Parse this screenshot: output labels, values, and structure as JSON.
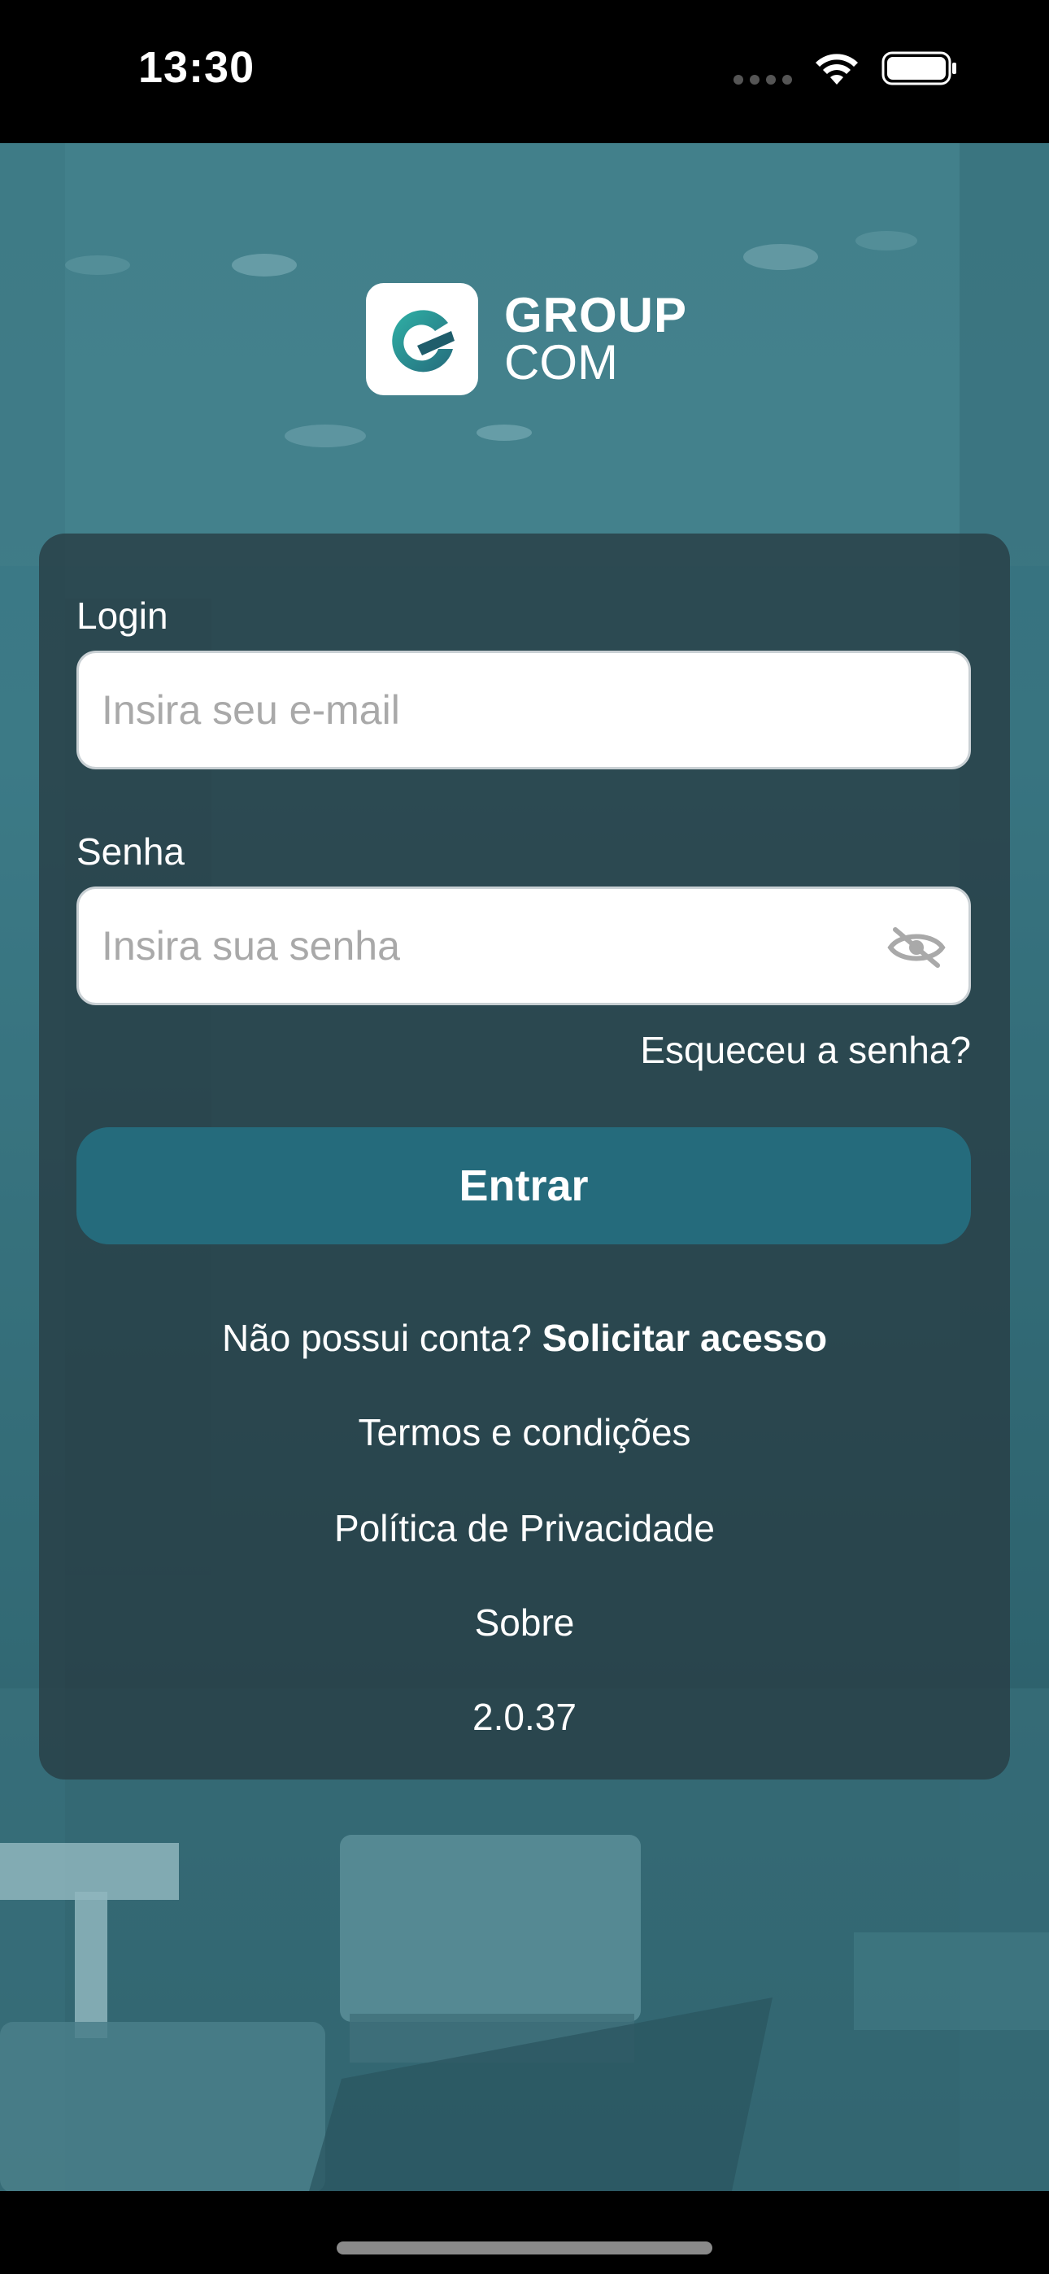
{
  "status_bar": {
    "time": "13:30"
  },
  "logo": {
    "line1": "GROUP",
    "line2": "COM"
  },
  "form": {
    "login_label": "Login",
    "login_placeholder": "Insira seu e-mail",
    "password_label": "Senha",
    "password_placeholder": "Insira sua senha",
    "forgot_password": "Esqueceu a senha?",
    "submit_label": "Entrar"
  },
  "links": {
    "no_account_text": "Não possui conta?",
    "request_access": "Solicitar acesso",
    "terms": "Termos e condições",
    "privacy": "Política de Privacidade",
    "about": "Sobre",
    "version": "2.0.37"
  },
  "colors": {
    "button": "#256b7c",
    "card": "#283e46",
    "background": "#3b7a86"
  }
}
